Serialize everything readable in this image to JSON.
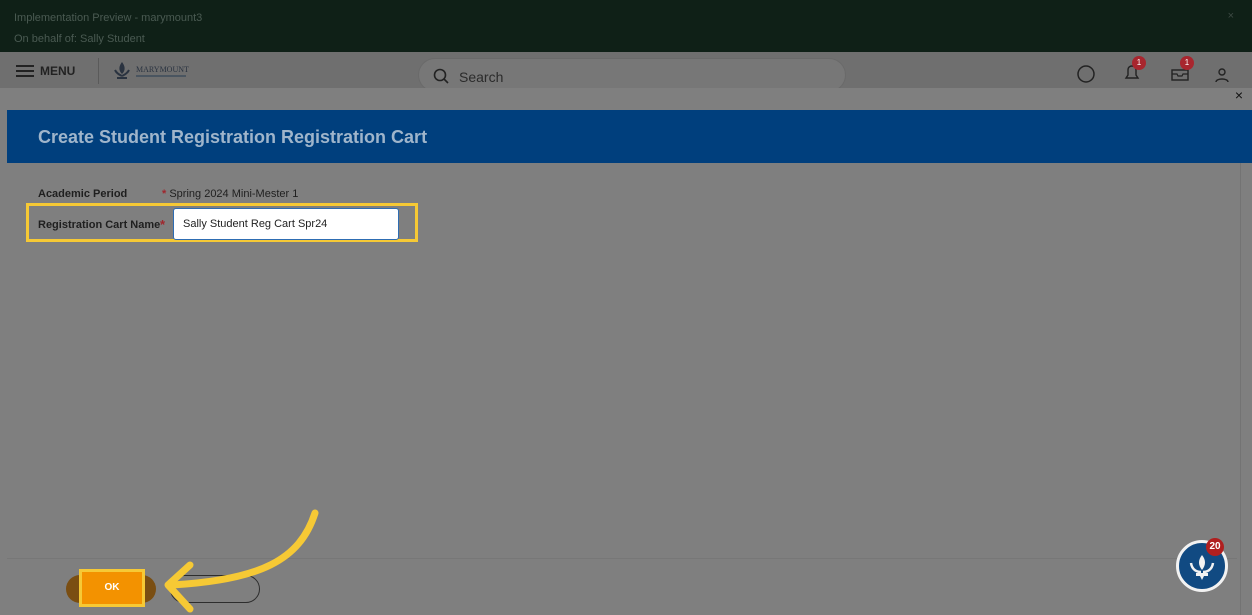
{
  "banner": {
    "environment": "Implementation Preview - marymount3",
    "on_behalf": "On behalf of: Sally Student",
    "close": "×"
  },
  "nav": {
    "menu_label": "MENU",
    "logo_text": "MARYMOUNT",
    "search_label": "Search",
    "notifications_count": "1",
    "inbox_count": "1"
  },
  "modal": {
    "close": "×",
    "title": "Create Student Registration Registration Cart",
    "academic_period_label": "Academic Period",
    "academic_period_required": "*",
    "academic_period_value": "Spring 2024 Mini-Mester 1",
    "cart_name_label": "Registration Cart Name",
    "cart_name_required": "*",
    "cart_name_value": "Sally Student Reg Cart Spr24",
    "ok_label": "OK"
  },
  "assistant": {
    "badge_count": "20"
  },
  "colors": {
    "header_blue": "#003f7d",
    "ok_orange": "#f39200",
    "highlight_yellow": "#f6c935",
    "required_red": "#a0262d"
  }
}
